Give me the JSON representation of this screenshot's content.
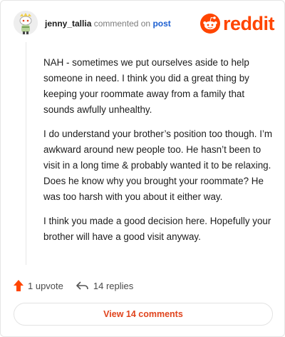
{
  "comment": {
    "username": "jenny_tallia",
    "connector": "commented on",
    "post_link": "post",
    "paragraphs": [
      "NAH - sometimes we put ourselves aside to help someone in need. I think you did a great thing by keeping your roommate away from a family that sounds awfully unhealthy.",
      "I do understand your brother’s position too though. I’m awkward around new people too. He hasn’t been to visit in a long time & probably wanted it to be relaxing. Does he know why you brought your roommate? He was too harsh with you about it either way.",
      "I think you made a good decision here. Hopefully your brother will have a good visit anyway."
    ]
  },
  "brand": {
    "name": "reddit",
    "icon": "reddit-snoo-icon",
    "color": "#ff4500"
  },
  "actions": {
    "upvote_label": "1 upvote",
    "upvote_icon": "upvote-arrow-icon",
    "upvote_color": "#ff4500",
    "replies_label": "14 replies",
    "replies_icon": "reply-arrow-icon"
  },
  "footer": {
    "view_comments_label": "View 14 comments"
  }
}
